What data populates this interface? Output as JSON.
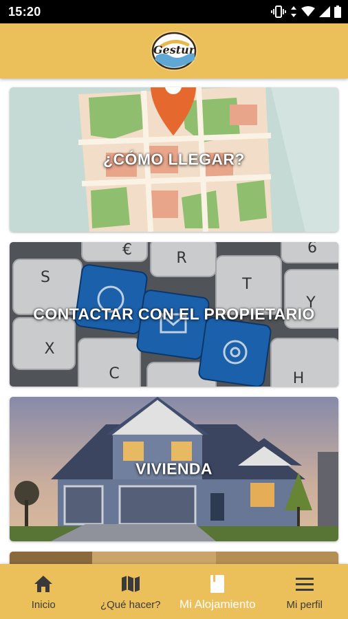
{
  "status_bar": {
    "time": "15:20"
  },
  "header": {
    "logo_text": "Gestur"
  },
  "cards": [
    {
      "label": "¿CÓMO LLEGAR?",
      "image": "map-with-pin"
    },
    {
      "label": "CONTACTAR CON EL PROPIETARIO",
      "image": "keyboard-contact-keys"
    },
    {
      "label": "VIVIENDA",
      "image": "house-at-dusk"
    }
  ],
  "keyboard_keys": [
    "€",
    "R",
    "T",
    "S",
    "Y",
    "X",
    "C",
    "H",
    "6"
  ],
  "bottom_nav": {
    "items": [
      {
        "label": "Inicio",
        "icon": "home-icon",
        "active": false
      },
      {
        "label": "¿Qué hacer?",
        "icon": "map-icon",
        "active": false
      },
      {
        "label": "Mi Alojamiento",
        "icon": "book-icon",
        "active": true
      },
      {
        "label": "Mi perfil",
        "icon": "menu-icon",
        "active": false
      }
    ]
  },
  "colors": {
    "header": "#ebbf59",
    "nav_text": "#3a3a3a",
    "nav_active": "#ffffff",
    "status_bar": "#000000"
  }
}
